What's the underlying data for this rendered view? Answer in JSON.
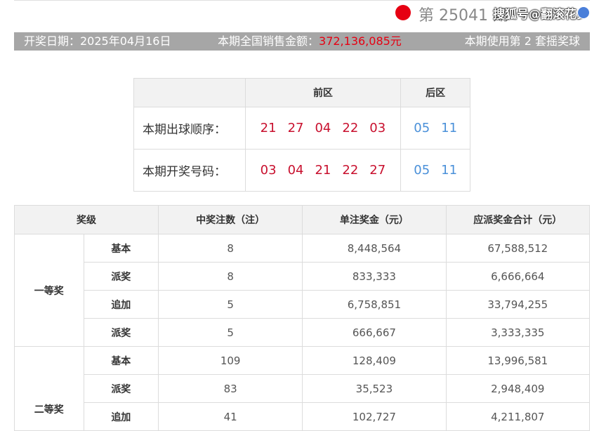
{
  "header": {
    "issue_text": "第 25041 期",
    "watermark": "搜狐号@翻滚花乡"
  },
  "info": {
    "date_label": "开奖日期：2025年04月16日",
    "sales_label": "本期全国销售金额：",
    "sales_value": "372,136,085元",
    "ball_set": "本期使用第 2 套摇奖球"
  },
  "draw": {
    "front_header": "前区",
    "back_header": "后区",
    "rows": [
      {
        "label": "本期出球顺序：",
        "front": [
          "21",
          "27",
          "04",
          "22",
          "03"
        ],
        "back": [
          "05",
          "11"
        ]
      },
      {
        "label": "本期开奖号码：",
        "front": [
          "03",
          "04",
          "21",
          "22",
          "27"
        ],
        "back": [
          "05",
          "11"
        ]
      }
    ]
  },
  "prizes": {
    "headers": [
      "奖级",
      "中奖注数（注）",
      "单注奖金（元）",
      "应派奖金合计（元）"
    ],
    "groups": [
      {
        "level": "一等奖",
        "rows": [
          {
            "sub": "基本",
            "count": "8",
            "single": "8,448,564",
            "total": "67,588,512"
          },
          {
            "sub": "派奖",
            "count": "8",
            "single": "833,333",
            "total": "6,666,664"
          },
          {
            "sub": "追加",
            "count": "5",
            "single": "6,758,851",
            "total": "33,794,255"
          },
          {
            "sub": "派奖",
            "count": "5",
            "single": "666,667",
            "total": "3,333,335"
          }
        ]
      },
      {
        "level": "二等奖",
        "rows": [
          {
            "sub": "基本",
            "count": "109",
            "single": "128,409",
            "total": "13,996,581"
          },
          {
            "sub": "派奖",
            "count": "83",
            "single": "35,523",
            "total": "2,948,409"
          },
          {
            "sub": "追加",
            "count": "41",
            "single": "102,727",
            "total": "4,211,807"
          }
        ]
      }
    ]
  },
  "colors": {
    "red": "#e60012",
    "blue": "#4a90d9",
    "bar": "#a6a6a6"
  }
}
